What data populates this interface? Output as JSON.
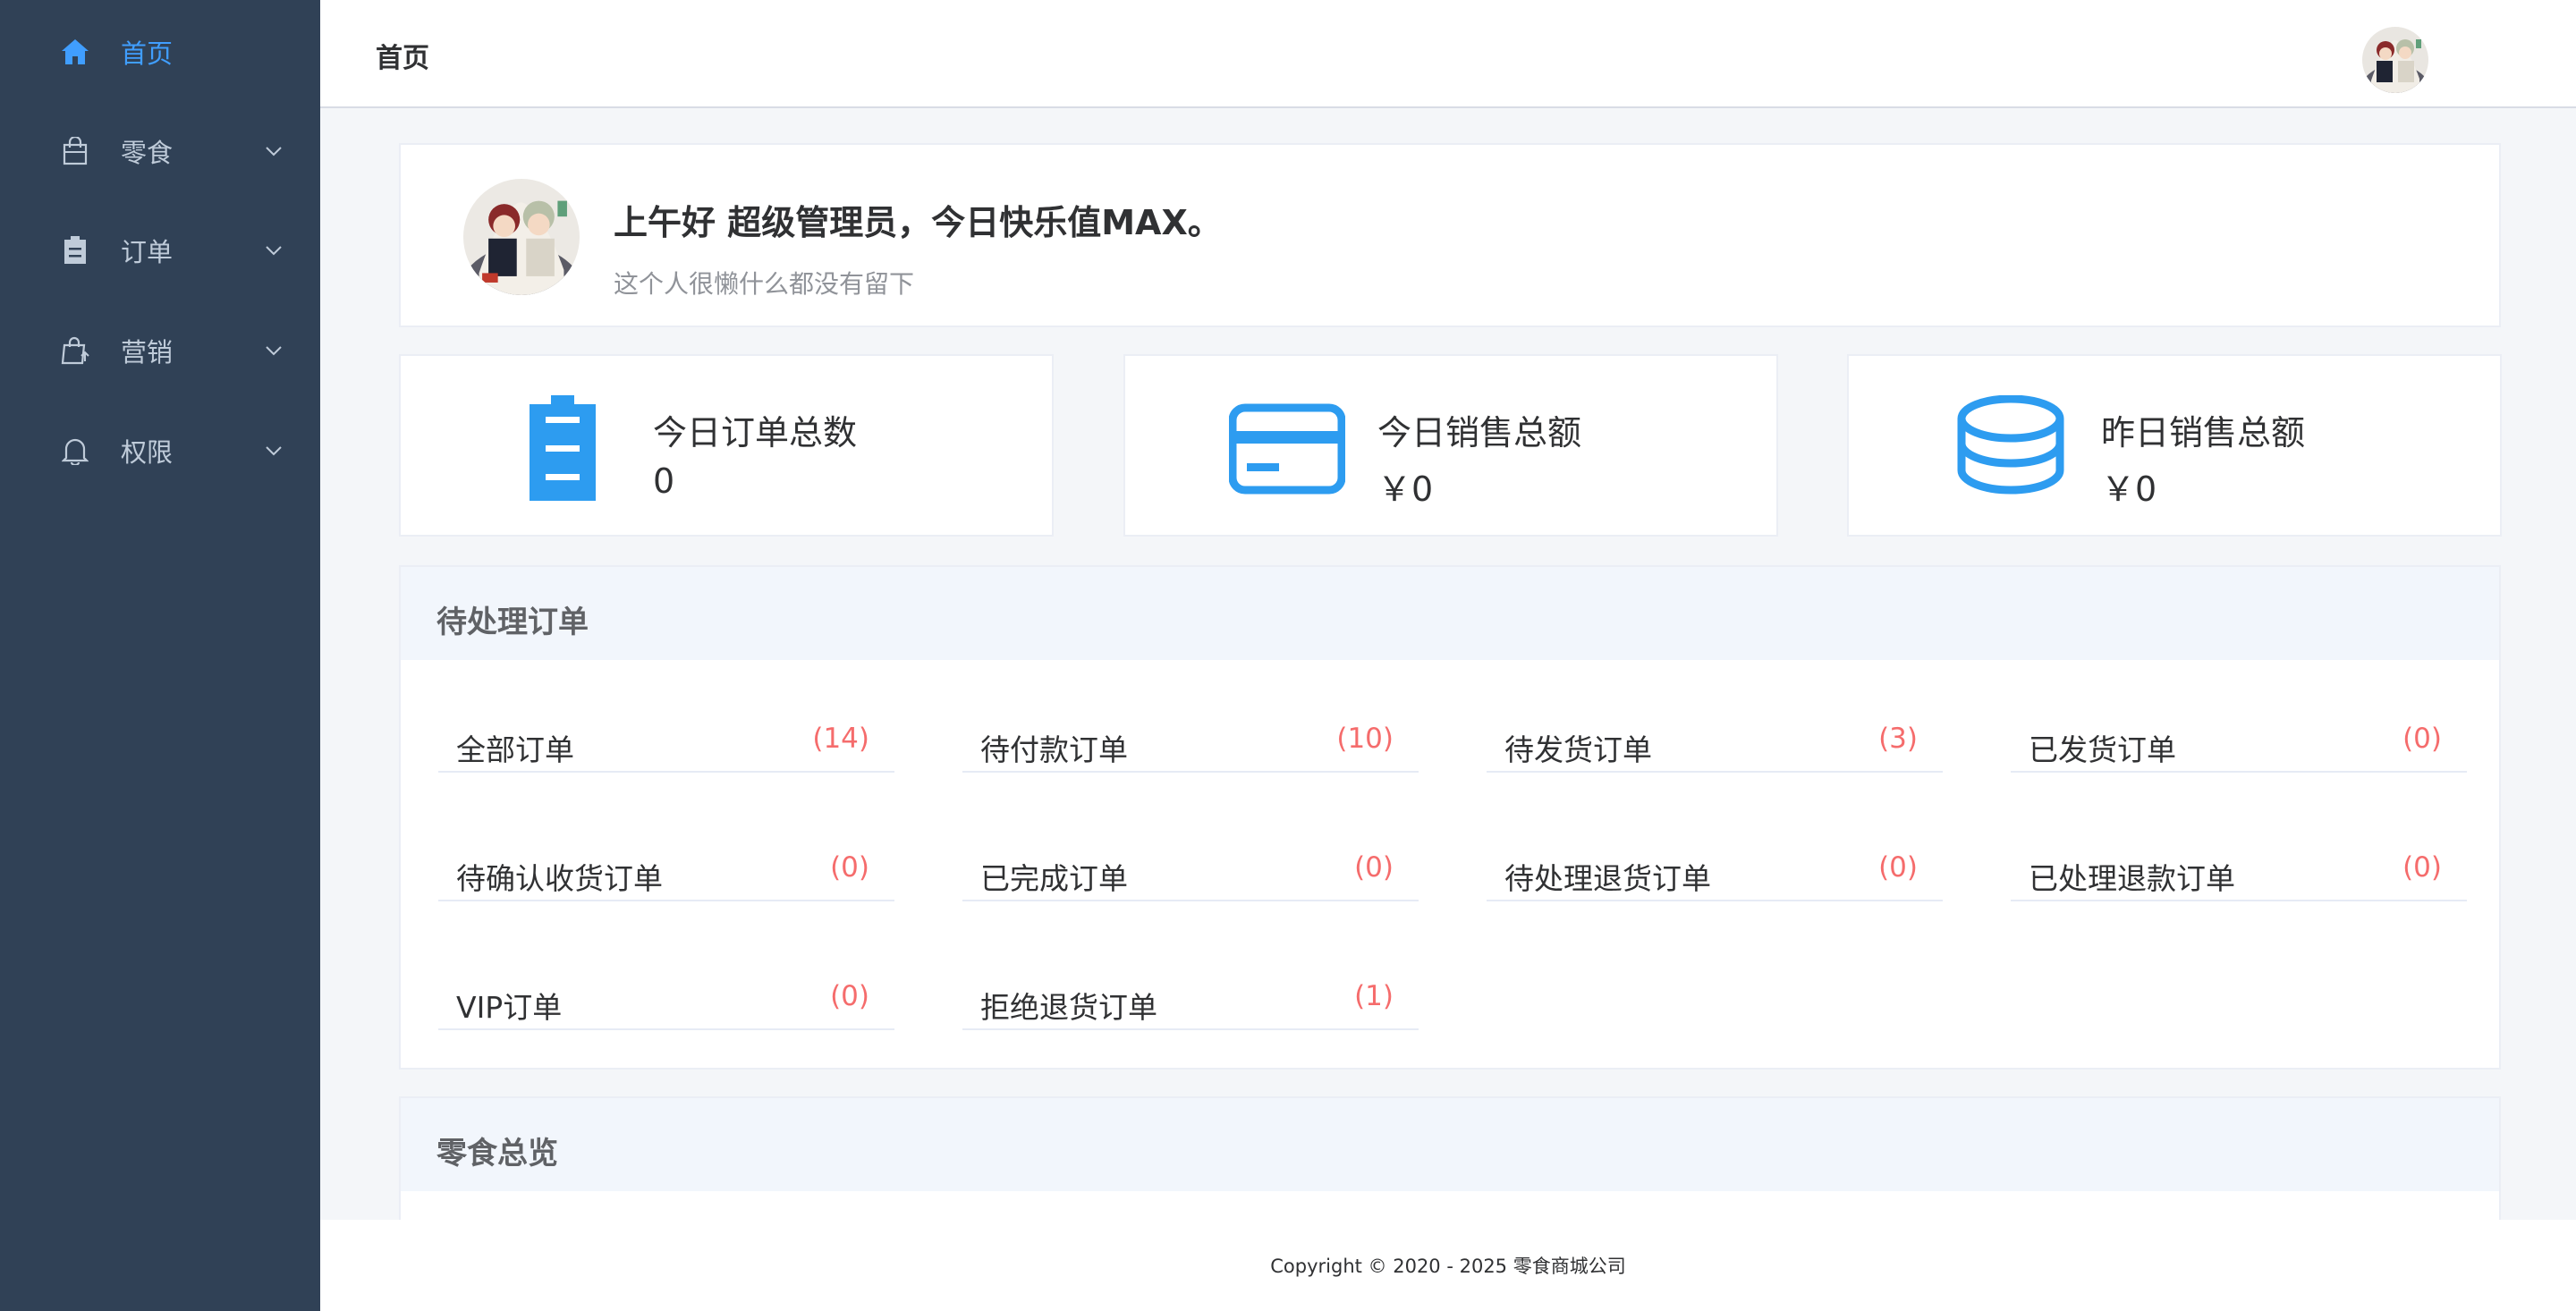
{
  "sidebar": {
    "items": [
      {
        "label": "首页",
        "icon": "home-icon",
        "active": true
      },
      {
        "label": "零食",
        "icon": "shopping-bag-icon"
      },
      {
        "label": "订单",
        "icon": "clipboard-icon"
      },
      {
        "label": "营销",
        "icon": "promotion-bag-icon"
      },
      {
        "label": "权限",
        "icon": "bell-icon"
      }
    ]
  },
  "header": {
    "title": "首页"
  },
  "welcome": {
    "greeting": "上午好 超级管理员，今日快乐值MAX。",
    "motto": "这个人很懒什么都没有留下"
  },
  "stats": [
    {
      "label": "今日订单总数",
      "value": "0",
      "icon": "clipboard-icon"
    },
    {
      "label": "今日销售总额",
      "value": "￥0",
      "icon": "credit-card-icon"
    },
    {
      "label": "昨日销售总额",
      "value": "￥0",
      "icon": "coins-stack-icon"
    }
  ],
  "pending_orders": {
    "title": "待处理订单",
    "items": [
      {
        "label": "全部订单",
        "count": "(14)"
      },
      {
        "label": "待付款订单",
        "count": "(10)"
      },
      {
        "label": "待发货订单",
        "count": "(3)"
      },
      {
        "label": "已发货订单",
        "count": "(0)"
      },
      {
        "label": "待确认收货订单",
        "count": "(0)"
      },
      {
        "label": "已完成订单",
        "count": "(0)"
      },
      {
        "label": "待处理退货订单",
        "count": "(0)"
      },
      {
        "label": "已处理退款订单",
        "count": "(0)"
      },
      {
        "label": "VIP订单",
        "count": "(0)"
      },
      {
        "label": "拒绝退货订单",
        "count": "(1)"
      }
    ]
  },
  "snack_overview": {
    "title": "零食总览"
  },
  "footer": {
    "copyright": "Copyright © 2020 - 2025   零食商城公司"
  },
  "colors": {
    "sidebar_bg": "#304156",
    "accent": "#409eff",
    "stat_icon": "#2d9cf0",
    "count": "#f56c6c"
  }
}
